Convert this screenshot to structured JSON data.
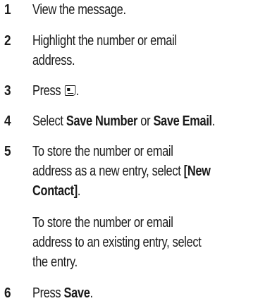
{
  "steps": [
    {
      "number": "1",
      "lines": [
        "View the message."
      ]
    },
    {
      "number": "2",
      "lines": [
        "Highlight the number or email",
        "address."
      ]
    },
    {
      "number": "3",
      "prefix": "Press",
      "suffix": "."
    },
    {
      "number": "4",
      "pre": "Select ",
      "bold1": "Save Number",
      "mid": " or ",
      "bold2": "Save Email",
      "post": "."
    },
    {
      "number": "5",
      "line1": "To store the number or email",
      "line2_pre": "address as a new entry, select ",
      "line2_bold": "[New",
      "line3_bold": "Contact]",
      "line3_post": ".",
      "note_lines": [
        "To store the number or email",
        "address to an existing entry, select",
        "the entry."
      ]
    },
    {
      "number": "6",
      "pre": "Press ",
      "bold": "Save",
      "post": "."
    }
  ],
  "icons": {
    "menu_key": "menu-key-icon"
  }
}
